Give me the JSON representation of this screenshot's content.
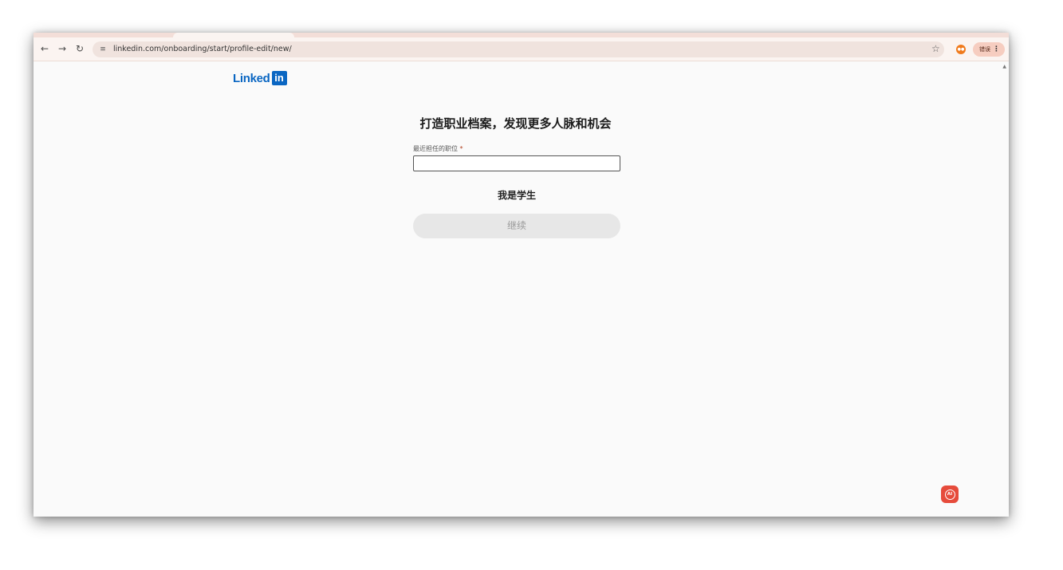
{
  "browser": {
    "url": "linkedin.com/onboarding/start/profile-edit/new/",
    "error_label": "错误"
  },
  "logo": {
    "word": "Linked",
    "box": "in"
  },
  "page": {
    "headline": "打造职业档案，发现更多人脉和机会",
    "job_title_label": "最近担任的职位",
    "required_mark": "*",
    "job_title_value": "",
    "student_link": "我是学生",
    "continue_label": "继续"
  },
  "colors": {
    "brand": "#0a66c2",
    "ai_button": "#e64b3b"
  }
}
